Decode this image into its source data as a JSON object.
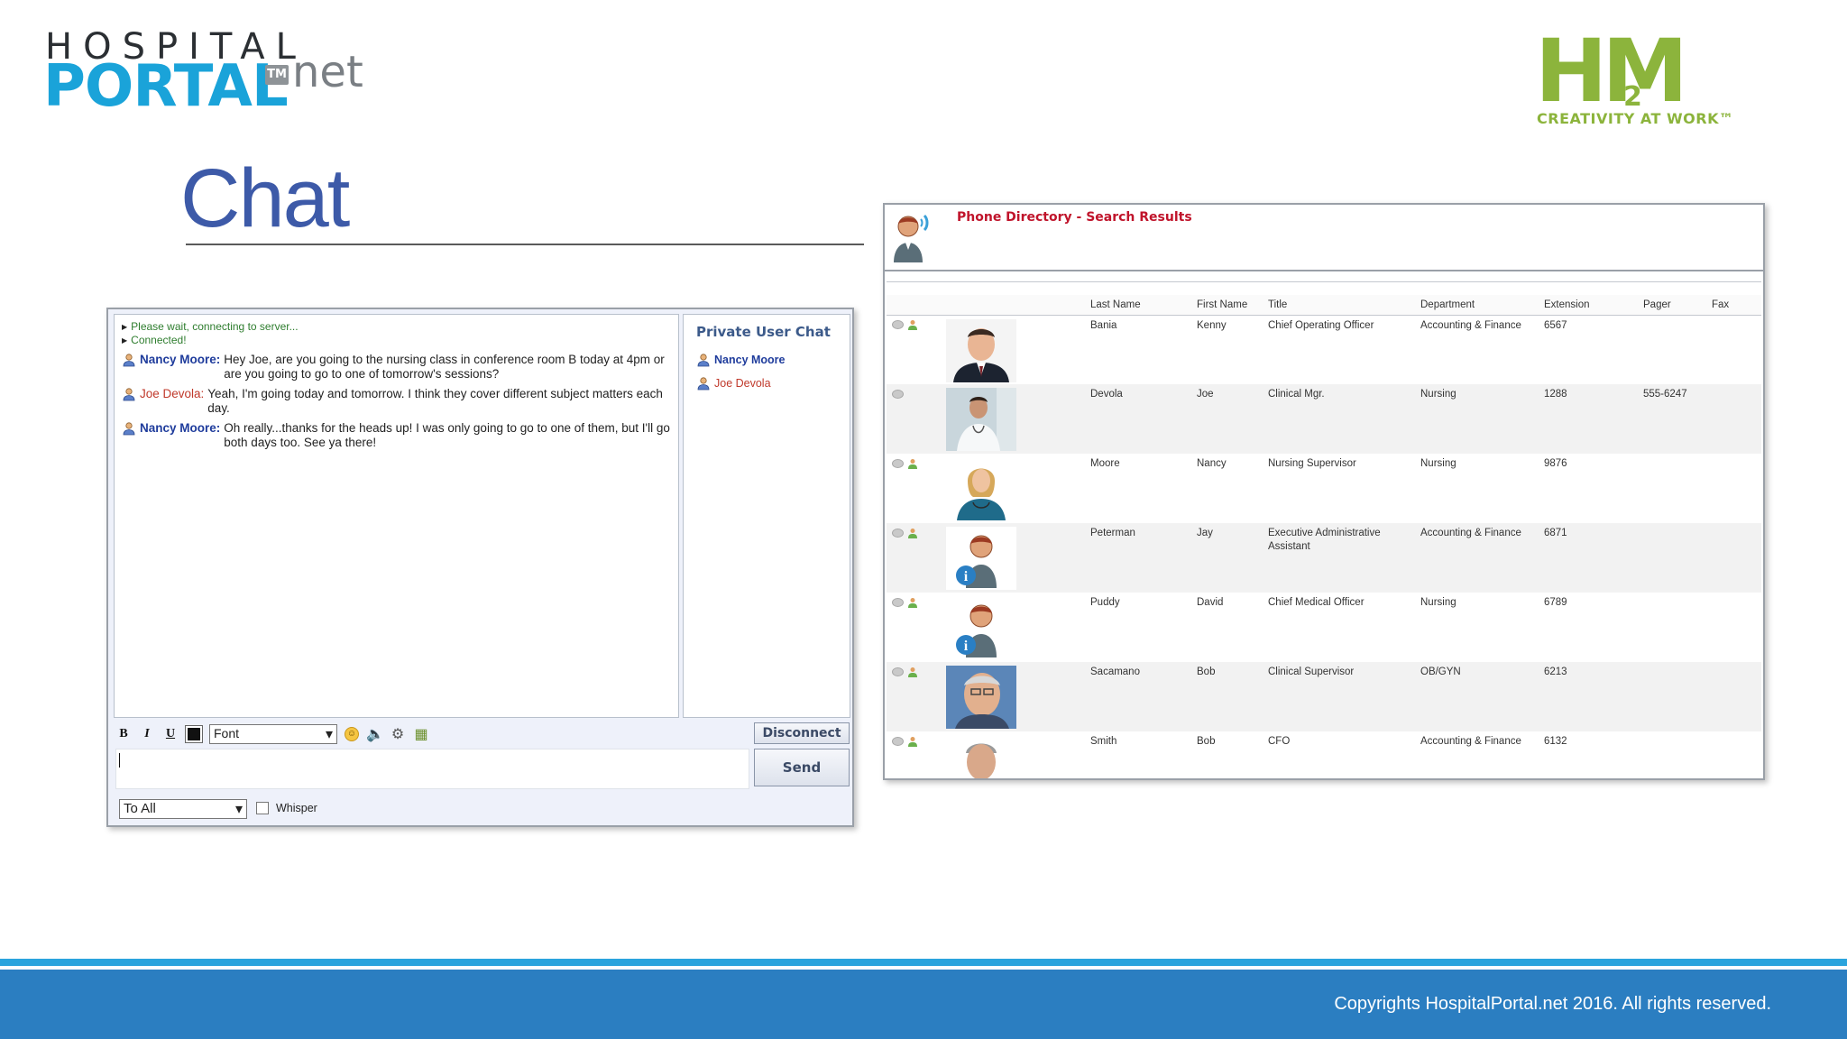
{
  "logos": {
    "left": {
      "line1": "HOSPITAL",
      "line2": "PORTAL",
      "tm": "TM",
      "suffix": "net"
    },
    "right": {
      "mark": "HM",
      "small": "2",
      "tagline": "CREATIVITY AT WORK™"
    }
  },
  "slide": {
    "title": "Chat"
  },
  "chat": {
    "system_lines": [
      "Please wait, connecting to server...",
      "Connected!"
    ],
    "messages": [
      {
        "user": "Nancy Moore:",
        "text": "Hey Joe, are you going to the nursing class in conference room B today at 4pm or are you going to go to one of tomorrow's sessions?"
      },
      {
        "user": "Joe Devola:",
        "text": "Yeah, I'm going today and tomorrow. I think they cover different subject matters each day."
      },
      {
        "user": "Nancy Moore:",
        "text": "Oh really...thanks for the heads up! I was only going to go to one of them, but I'll go both days too. See ya there!"
      }
    ],
    "private_panel": {
      "header": "Private User Chat",
      "users": [
        "Nancy Moore",
        "Joe Devola"
      ]
    },
    "toolbar": {
      "bold": "B",
      "italic": "I",
      "underline": "U",
      "font_select": "Font"
    },
    "disconnect_label": "Disconnect",
    "send_label": "Send",
    "message_input_value": "",
    "to_select": "To All",
    "whisper_label": "Whisper",
    "colors": {
      "blue_user": "#1f3c9c",
      "red_user": "#c0392b",
      "system": "#2e7d2e"
    }
  },
  "directory": {
    "title": "Phone Directory - Search Results",
    "columns": [
      "Last Name",
      "First Name",
      "Title",
      "Department",
      "Extension",
      "Pager",
      "Fax"
    ],
    "rows": [
      {
        "last": "Bania",
        "first": "Kenny",
        "title": "Chief Operating Officer",
        "dept": "Accounting & Finance",
        "ext": "6567",
        "pager": "",
        "fax": ""
      },
      {
        "last": "Devola",
        "first": "Joe",
        "title": "Clinical Mgr.",
        "dept": "Nursing",
        "ext": "1288",
        "pager": "555-6247",
        "fax": ""
      },
      {
        "last": "Moore",
        "first": "Nancy",
        "title": "Nursing Supervisor",
        "dept": "Nursing",
        "ext": "9876",
        "pager": "",
        "fax": ""
      },
      {
        "last": "Peterman",
        "first": "Jay",
        "title": "Executive Administrative Assistant",
        "dept": "Accounting & Finance",
        "ext": "6871",
        "pager": "",
        "fax": ""
      },
      {
        "last": "Puddy",
        "first": "David",
        "title": "Chief Medical Officer",
        "dept": "Nursing",
        "ext": "6789",
        "pager": "",
        "fax": ""
      },
      {
        "last": "Sacamano",
        "first": "Bob",
        "title": "Clinical Supervisor",
        "dept": "OB/GYN",
        "ext": "6213",
        "pager": "",
        "fax": ""
      },
      {
        "last": "Smith",
        "first": "Bob",
        "title": "CFO",
        "dept": "Accounting & Finance",
        "ext": "6132",
        "pager": "",
        "fax": ""
      }
    ]
  },
  "footer": {
    "copyright": "Copyrights HospitalPortal.net 2016. All rights reserved."
  }
}
